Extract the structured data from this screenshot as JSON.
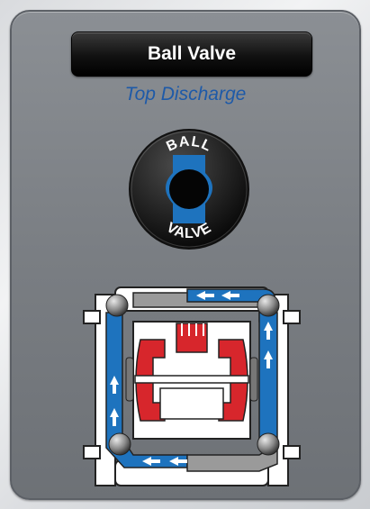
{
  "header": {
    "title": "Ball Valve",
    "subtitle": "Top Discharge"
  },
  "badge": {
    "top_text": "BALL",
    "bottom_text": "VALVE",
    "icon": "ball-valve-icon"
  },
  "diagram": {
    "icon": "diaphragm-pump-cutaway"
  },
  "colors": {
    "flow_blue": "#1e73be",
    "chamber_red": "#d7262c",
    "title_text": "#ffffff",
    "subtitle_text": "#1e5aa8"
  }
}
